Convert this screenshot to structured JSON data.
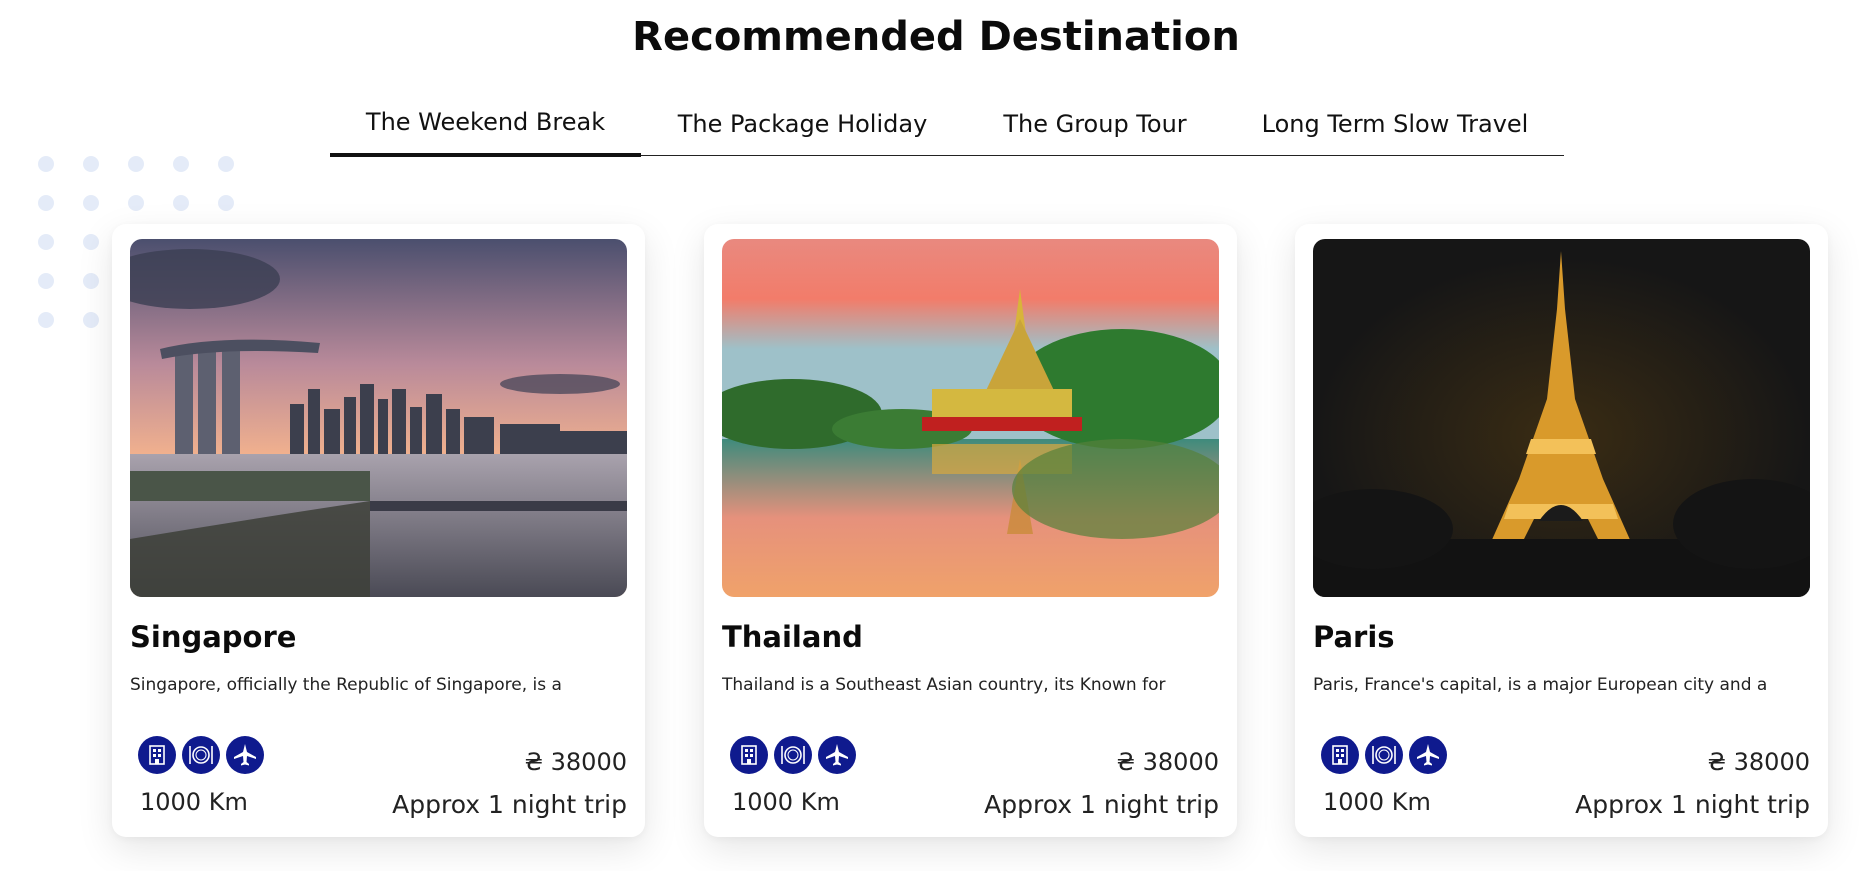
{
  "section": {
    "title": "Recommended Destination"
  },
  "tabs": [
    {
      "label": "The Weekend Break",
      "active": true
    },
    {
      "label": "The Package Holiday",
      "active": false
    },
    {
      "label": "The Group Tour",
      "active": false
    },
    {
      "label": "Long Term Slow Travel",
      "active": false
    }
  ],
  "colors": {
    "icon_bg": "#0f1a8e",
    "decor_dots": "#e4ebf8"
  },
  "cards": [
    {
      "name": "Singapore",
      "description": "Singapore, officially the Republic of Singapore, is a",
      "image_icon": "singapore-skyline-photo",
      "amenity_icons": [
        "hotel-icon",
        "dining-icon",
        "flight-icon"
      ],
      "price": "₴ 38000",
      "distance": "1000 Km",
      "duration": "Approx 1 night trip"
    },
    {
      "name": "Thailand",
      "description": "Thailand is a Southeast Asian country, its Known for",
      "image_icon": "thailand-temple-photo",
      "amenity_icons": [
        "hotel-icon",
        "dining-icon",
        "flight-icon"
      ],
      "price": "₴ 38000",
      "distance": "1000 Km",
      "duration": "Approx 1 night trip"
    },
    {
      "name": "Paris",
      "description": "Paris, France's capital, is a major European city and a",
      "image_icon": "eiffel-tower-photo",
      "amenity_icons": [
        "hotel-icon",
        "dining-icon",
        "flight-icon"
      ],
      "price": "₴ 38000",
      "distance": "1000 Km",
      "duration": "Approx 1 night trip"
    }
  ]
}
